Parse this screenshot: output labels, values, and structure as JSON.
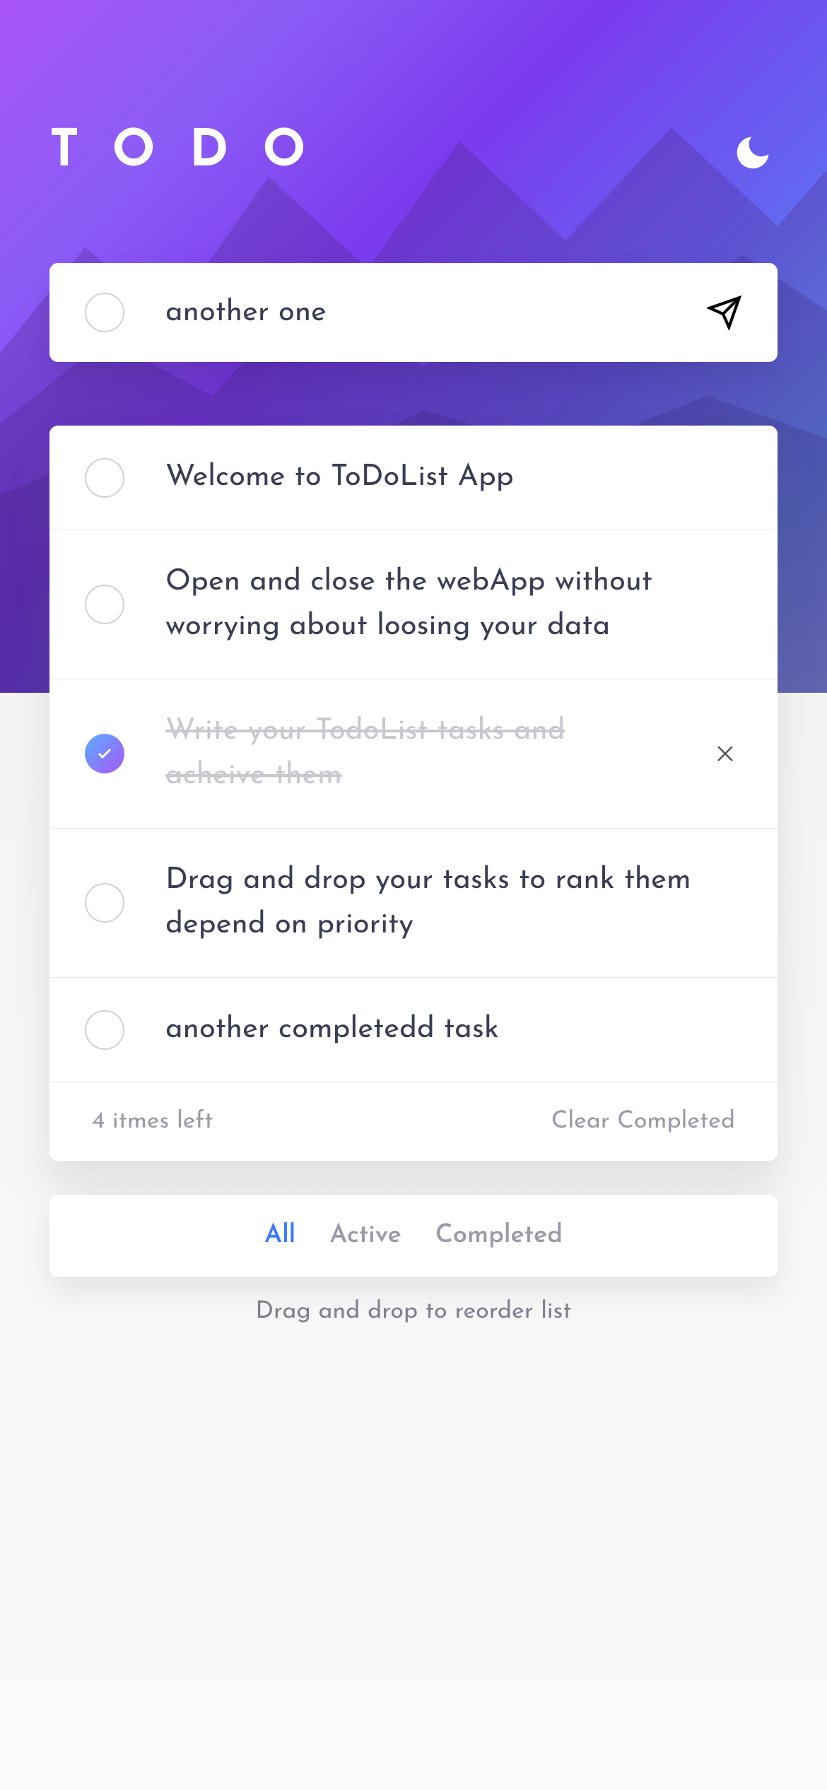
{
  "header": {
    "logo": "TODO"
  },
  "input": {
    "value": "another one"
  },
  "todos": [
    {
      "text": "Welcome to ToDoList App",
      "completed": false,
      "showDelete": false
    },
    {
      "text": "Open and close the webApp without worrying about loosing your data",
      "completed": false,
      "showDelete": false
    },
    {
      "text": "Write your TodoList tasks and acheive them",
      "completed": true,
      "showDelete": true
    },
    {
      "text": "Drag and drop your tasks to rank them depend on priority",
      "completed": false,
      "showDelete": false
    },
    {
      "text": "another completedd task",
      "completed": false,
      "showDelete": false
    }
  ],
  "footer": {
    "itemsLeft": "4 itmes left",
    "clearLabel": "Clear Completed"
  },
  "filters": {
    "all": "All",
    "active": "Active",
    "completed": "Completed",
    "selected": "all"
  },
  "hint": "Drag and drop to reorder list"
}
